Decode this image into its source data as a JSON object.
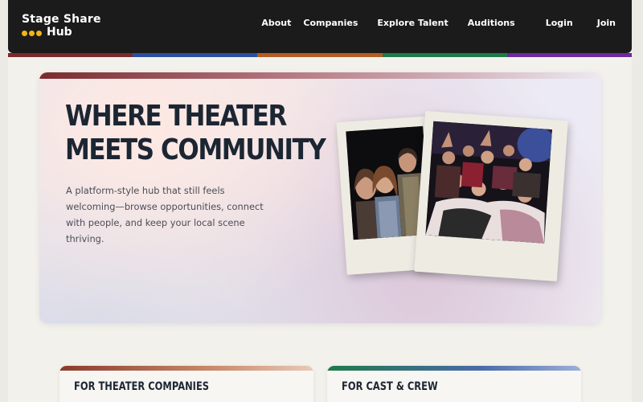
{
  "brand": {
    "line1": "Stage Share",
    "line2": "Hub",
    "dot_color": "#f2b417"
  },
  "nav": {
    "links": [
      {
        "label": "About"
      },
      {
        "label": "Companies"
      },
      {
        "label": "Explore Talent"
      },
      {
        "label": "Auditions"
      },
      {
        "label": "Login"
      },
      {
        "label": "Join"
      }
    ]
  },
  "stripe_colors": [
    "#7a2a2c",
    "#2c4ea1",
    "#b45c23",
    "#1e7a4a",
    "#6b2aa0"
  ],
  "hero": {
    "title_line1": "WHERE THEATER",
    "title_line2": "MEETS COMMUNITY",
    "description": "A platform-style hub that still feels welcoming—browse opportunities, connect with people, and keep your local scene thriving.",
    "photos": [
      {
        "icon": "theater-cast-photo-icon"
      },
      {
        "icon": "theater-ensemble-photo-icon"
      }
    ]
  },
  "cards": [
    {
      "title": "FOR THEATER COMPANIES",
      "accent": "#8a3b2c"
    },
    {
      "title": "FOR CAST & CREW",
      "accent": "#1e7a4a"
    }
  ]
}
